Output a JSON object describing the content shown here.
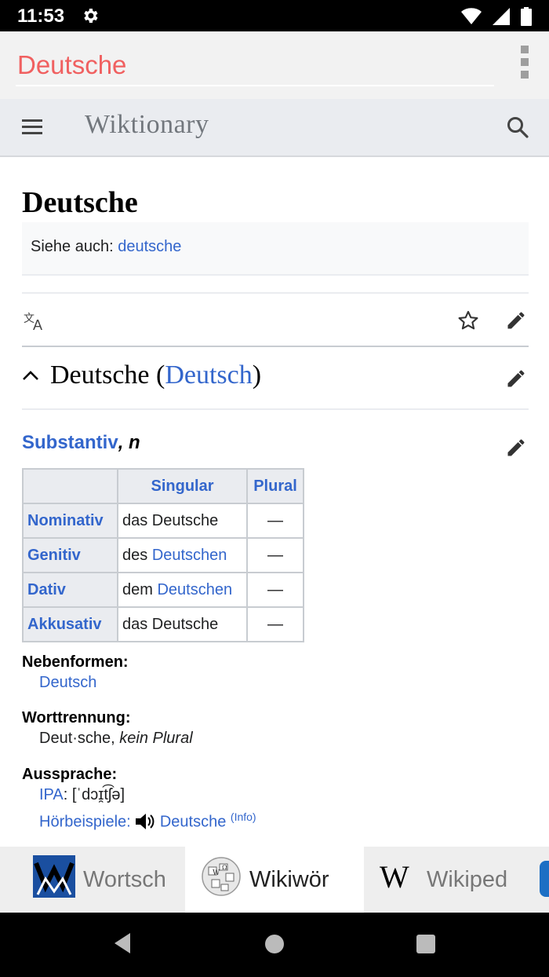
{
  "statusbar": {
    "time": "11:53"
  },
  "searchbar": {
    "query": "Deutsche"
  },
  "wiki": {
    "logo": "Wiktionary"
  },
  "page": {
    "title": "Deutsche",
    "see_also_label": "Siehe auch:",
    "see_also_link": "deutsche"
  },
  "section": {
    "word": "Deutsche",
    "paren_open": " (",
    "language": "Deutsch",
    "paren_close": ")"
  },
  "pos": {
    "label": "Substantiv",
    "sep": ", ",
    "gender": "n"
  },
  "table": {
    "headers": [
      "Singular",
      "Plural"
    ],
    "rows": [
      {
        "case": "Nominativ",
        "article": "das Deutsche",
        "link": "",
        "plural": "—"
      },
      {
        "case": "Genitiv",
        "article": "des ",
        "link": "Deutschen",
        "plural": "—"
      },
      {
        "case": "Dativ",
        "article": "dem ",
        "link": "Deutschen",
        "plural": "—"
      },
      {
        "case": "Akkusativ",
        "article": "das Deutsche",
        "link": "",
        "plural": "—"
      }
    ]
  },
  "nebenformen": {
    "label": "Nebenformen:",
    "value": "Deutsch"
  },
  "worttrennung": {
    "label": "Worttrennung:",
    "value": "Deut·sche, ",
    "note": "kein Plural"
  },
  "aussprache": {
    "label": "Aussprache:",
    "ipa_label": "IPA",
    "ipa_value": ": [ˈdɔɪ̯t͡ʃə]",
    "audio_label": "Hörbeispiele:",
    "audio_word": "Deutsche",
    "info": "(Info)"
  },
  "tabs": [
    {
      "label": "Wortsch",
      "icon": "wortschatz-logo-icon"
    },
    {
      "label": "Wikiwör",
      "icon": "wikipedia-globe-icon"
    },
    {
      "label": "Wikiped",
      "icon": "wikipedia-w-icon"
    }
  ],
  "colors": {
    "link": "#3366cc",
    "accent": "#f06060"
  }
}
